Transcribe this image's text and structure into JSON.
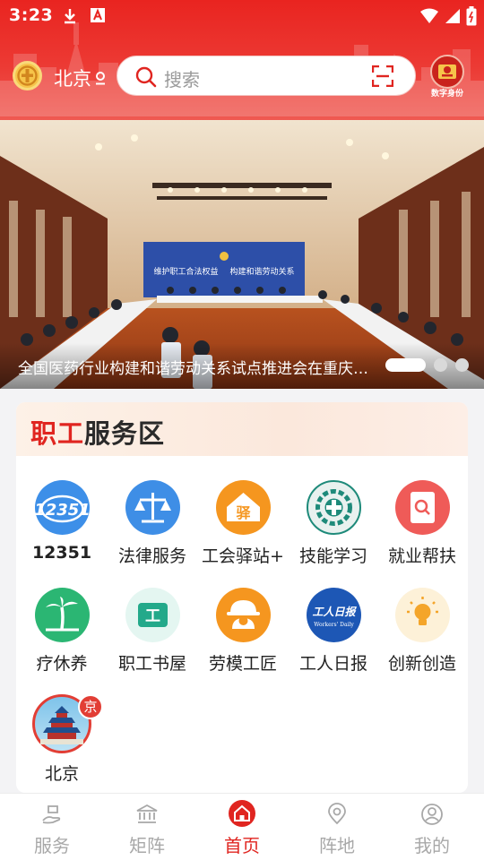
{
  "status_bar": {
    "time": "3:23"
  },
  "header": {
    "city": "北京",
    "search_placeholder": "搜索",
    "id_badge_label": "数字身份"
  },
  "banner": {
    "caption": "全国医药行业构建和谐劳动关系试点推进会在重庆召开",
    "backdrop_text_left": "维护职工合法权益",
    "backdrop_text_right": "构建和谐劳动关系",
    "slide_count": 3,
    "active_slide": 1
  },
  "service_area": {
    "title_accent": "职工",
    "title_rest": "服务区",
    "items": [
      {
        "label": "12351",
        "icon": "hotline-12351-icon"
      },
      {
        "label": "法律服务",
        "icon": "legal-scales-icon"
      },
      {
        "label": "工会驿站+",
        "icon": "union-station-icon",
        "icon_text": "驿"
      },
      {
        "label": "技能学习",
        "icon": "skill-gear-icon"
      },
      {
        "label": "就业帮扶",
        "icon": "job-search-icon"
      },
      {
        "label": "疗休养",
        "icon": "palm-tree-icon"
      },
      {
        "label": "职工书屋",
        "icon": "bookhouse-icon",
        "icon_text": "工"
      },
      {
        "label": "劳模工匠",
        "icon": "worker-helmet-icon"
      },
      {
        "label": "工人日报",
        "icon": "workers-daily-icon",
        "icon_text": "工人日报",
        "icon_subtext": "Workers' Daily"
      },
      {
        "label": "创新创造",
        "icon": "lightbulb-icon"
      },
      {
        "label": "北京",
        "icon": "temple-of-heaven-icon",
        "badge": "京"
      }
    ]
  },
  "bottom_nav": {
    "items": [
      {
        "label": "服务",
        "icon": "service-hand-icon"
      },
      {
        "label": "矩阵",
        "icon": "bank-building-icon"
      },
      {
        "label": "首页",
        "icon": "home-icon",
        "active": true
      },
      {
        "label": "阵地",
        "icon": "location-pin-icon"
      },
      {
        "label": "我的",
        "icon": "profile-icon"
      }
    ]
  },
  "colors": {
    "brand_red": "#e02520",
    "header_red": "#e92420",
    "nav_inactive": "#a8a8a8"
  }
}
